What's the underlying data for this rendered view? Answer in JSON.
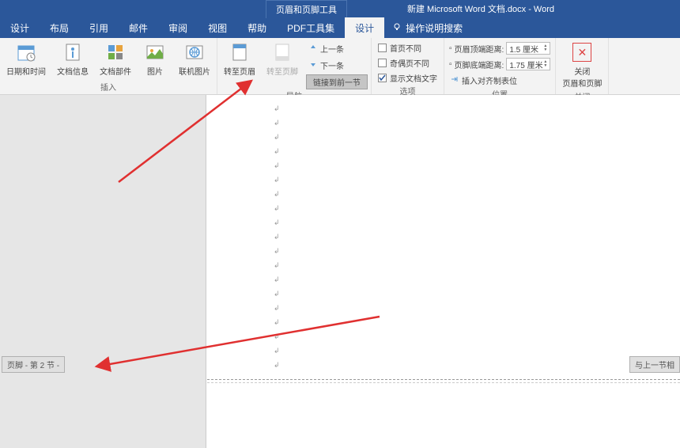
{
  "title_bar": {
    "context_title": "页眉和页脚工具",
    "doc_title": "新建 Microsoft Word 文档.docx - Word"
  },
  "tabs": {
    "items": [
      "设计",
      "布局",
      "引用",
      "邮件",
      "审阅",
      "视图",
      "帮助",
      "PDF工具集"
    ],
    "context_tab": "设计",
    "tell_me": "操作说明搜索"
  },
  "ribbon": {
    "group_insert": {
      "label": "插入",
      "date_time": "日期和时间",
      "doc_info": "文档信息",
      "doc_parts": "文档部件",
      "picture": "图片",
      "online_pic": "联机图片"
    },
    "group_nav": {
      "label": "导航",
      "goto_header": "转至页眉",
      "goto_footer": "转至页脚",
      "prev": "上一条",
      "next": "下一条",
      "link_prev": "链接到前一节"
    },
    "group_options": {
      "label": "选项",
      "first_diff": "首页不同",
      "odd_even_diff": "奇偶页不同",
      "show_doc_text": "显示文档文字"
    },
    "group_position": {
      "label": "位置",
      "header_top": "页眉顶端距离:",
      "header_top_val": "1.5 厘米",
      "footer_bottom": "页脚底端距离:",
      "footer_bottom_val": "1.75 厘米",
      "align_tabs": "插入对齐制表位"
    },
    "group_close": {
      "label": "关闭",
      "close_btn_line1": "关闭",
      "close_btn_line2": "页眉和页脚"
    }
  },
  "document": {
    "footer_tag": "页脚 - 第 2 节 -",
    "footer_tag_right": "与上一节相"
  }
}
